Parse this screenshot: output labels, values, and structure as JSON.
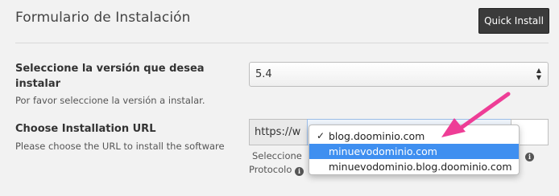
{
  "header": {
    "title": "Formulario de Instalación",
    "quick_install_label": "Quick Install"
  },
  "version_field": {
    "label": "Seleccione la versión que desea instalar",
    "help": "Por favor seleccione la versión a instalar.",
    "selected_value": "5.4"
  },
  "url_field": {
    "label": "Choose Installation URL",
    "help": "Please choose the URL to install the software",
    "protocol_value": "https://w",
    "protocol_caption_line1": "Seleccione",
    "protocol_caption_line2": "Protocolo"
  },
  "domain_dropdown": {
    "options": [
      {
        "label": "blog.doominio.com",
        "checked": true
      },
      {
        "label": "minuevodominio.com",
        "highlighted": true
      },
      {
        "label": "minuevodominio.blog.doominio.com"
      }
    ]
  },
  "icons": {
    "info": "info-icon",
    "check": "checkmark-icon",
    "select_arrows": "up-down-arrows-icon",
    "annotation": "pink-arrow-annotation"
  },
  "colors": {
    "highlight": "#3f8ff0",
    "annotation_arrow": "#ee3d96",
    "button_bg": "#3b3b3b"
  }
}
